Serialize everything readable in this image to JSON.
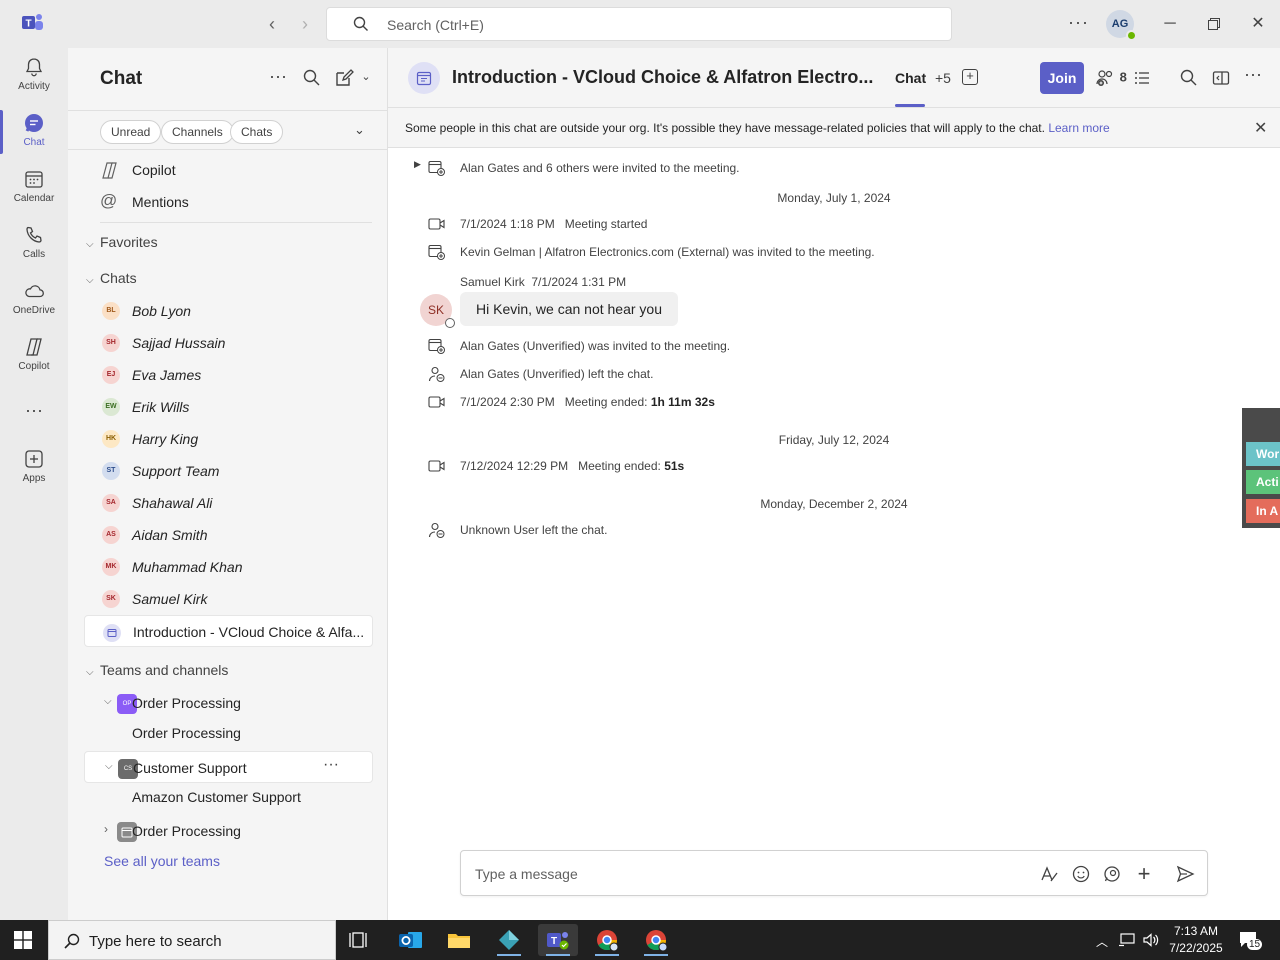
{
  "titlebar": {
    "search_placeholder": "Search (Ctrl+E)",
    "more_label": "···",
    "user_initials": "AG"
  },
  "rail": {
    "items": [
      {
        "label": "Activity",
        "icon": "bell-icon"
      },
      {
        "label": "Chat",
        "icon": "chat-icon"
      },
      {
        "label": "Calendar",
        "icon": "calendar-icon"
      },
      {
        "label": "Calls",
        "icon": "phone-icon"
      },
      {
        "label": "OneDrive",
        "icon": "cloud-icon"
      },
      {
        "label": "Copilot",
        "icon": "copilot-icon"
      },
      {
        "label": "Apps",
        "icon": "apps-icon"
      }
    ],
    "more_label": "···"
  },
  "listpane": {
    "title": "Chat",
    "filters": [
      "Unread",
      "Channels",
      "Chats"
    ],
    "pinned": [
      {
        "label": "Copilot",
        "icon": "copilot-icon"
      },
      {
        "label": "Mentions",
        "icon": "at-icon"
      }
    ],
    "favorites_label": "Favorites",
    "chats_label": "Chats",
    "chats": [
      {
        "name": "Bob Lyon",
        "initials": "BL",
        "bg": "#fbe0c6",
        "fg": "#a05a1c"
      },
      {
        "name": "Sajjad Hussain",
        "initials": "SH",
        "bg": "#f6d4d1",
        "fg": "#a4262c"
      },
      {
        "name": "Eva James",
        "initials": "EJ",
        "bg": "#f6d4d1",
        "fg": "#a4262c"
      },
      {
        "name": "Erik Wills",
        "initials": "EW",
        "bg": "#dbe8d3",
        "fg": "#3b6e22"
      },
      {
        "name": "Harry King",
        "initials": "HK",
        "bg": "#fde8c4",
        "fg": "#8a5d00"
      },
      {
        "name": "Support Team",
        "initials": "ST",
        "bg": "#d3ddef",
        "fg": "#2c4c8a"
      },
      {
        "name": "Shahawal Ali",
        "initials": "SA",
        "bg": "#f6d4d1",
        "fg": "#a4262c"
      },
      {
        "name": "Aidan Smith",
        "initials": "AS",
        "bg": "#f6d4d1",
        "fg": "#a4262c"
      },
      {
        "name": "Muhammad Khan",
        "initials": "MK",
        "bg": "#f6d4d1",
        "fg": "#a4262c"
      },
      {
        "name": "Samuel Kirk",
        "initials": "SK",
        "bg": "#f6d4d1",
        "fg": "#a4262c"
      }
    ],
    "selected_chat": "Introduction - VCloud Choice & Alfa...",
    "teams_label": "Teams and channels",
    "teams": [
      {
        "team": "Order Processing",
        "abbr": "OP",
        "color": "#8b5cf6",
        "channel": "Order Processing"
      },
      {
        "team": "Customer Support",
        "abbr": "CS",
        "color": "#6b6b6b",
        "channel": "Amazon Customer Support"
      },
      {
        "team": "Order Processing",
        "abbr": "",
        "color": "#8a8a8a"
      }
    ],
    "see_all": "See all your teams"
  },
  "header": {
    "title": "Introduction - VCloud Choice & Alfatron Electro...",
    "tab_chat": "Chat",
    "tab_more": "+5",
    "join_label": "Join",
    "participants_count": "8"
  },
  "banner": {
    "text": "Some people in this chat are outside your org. It's possible they have message-related policies that will apply to the chat.",
    "link": "Learn more"
  },
  "messages": {
    "invited_top": "Alan Gates and 6 others were invited to the meeting.",
    "date1": "Monday, July 1, 2024",
    "meeting_started_time": "7/1/2024 1:18 PM",
    "meeting_started_label": "Meeting started",
    "kevin_invited": "Kevin Gelman | Alfatron Electronics.com (External) was invited to the meeting.",
    "sk_sender": "Samuel Kirk",
    "sk_time": "7/1/2024 1:31 PM",
    "sk_initials": "SK",
    "sk_text": "Hi Kevin, we can not hear you",
    "alan_invited": "Alan Gates (Unverified) was invited to the meeting.",
    "alan_left": "Alan Gates (Unverified) left the chat.",
    "ended1_time": "7/1/2024 2:30 PM",
    "ended_label": "Meeting ended:",
    "ended1_duration": "1h 11m 32s",
    "date2": "Friday, July 12, 2024",
    "ended2_time": "7/12/2024 12:29 PM",
    "ended2_duration": "51s",
    "date3": "Monday, December 2, 2024",
    "unknown_left": "Unknown User left the chat."
  },
  "side_widget": [
    {
      "label": "Wor",
      "color": "#6cc3c8"
    },
    {
      "label": "Acti",
      "color": "#5cc37a"
    },
    {
      "label": "In A",
      "color": "#e46c5b"
    }
  ],
  "composer": {
    "placeholder": "Type a message"
  },
  "taskbar": {
    "search_placeholder": "Type here to search",
    "time": "7:13 AM",
    "date": "7/22/2025",
    "notifications": "15"
  },
  "colors": {
    "accent": "#5b5fc7",
    "presence": "#6bb700"
  }
}
